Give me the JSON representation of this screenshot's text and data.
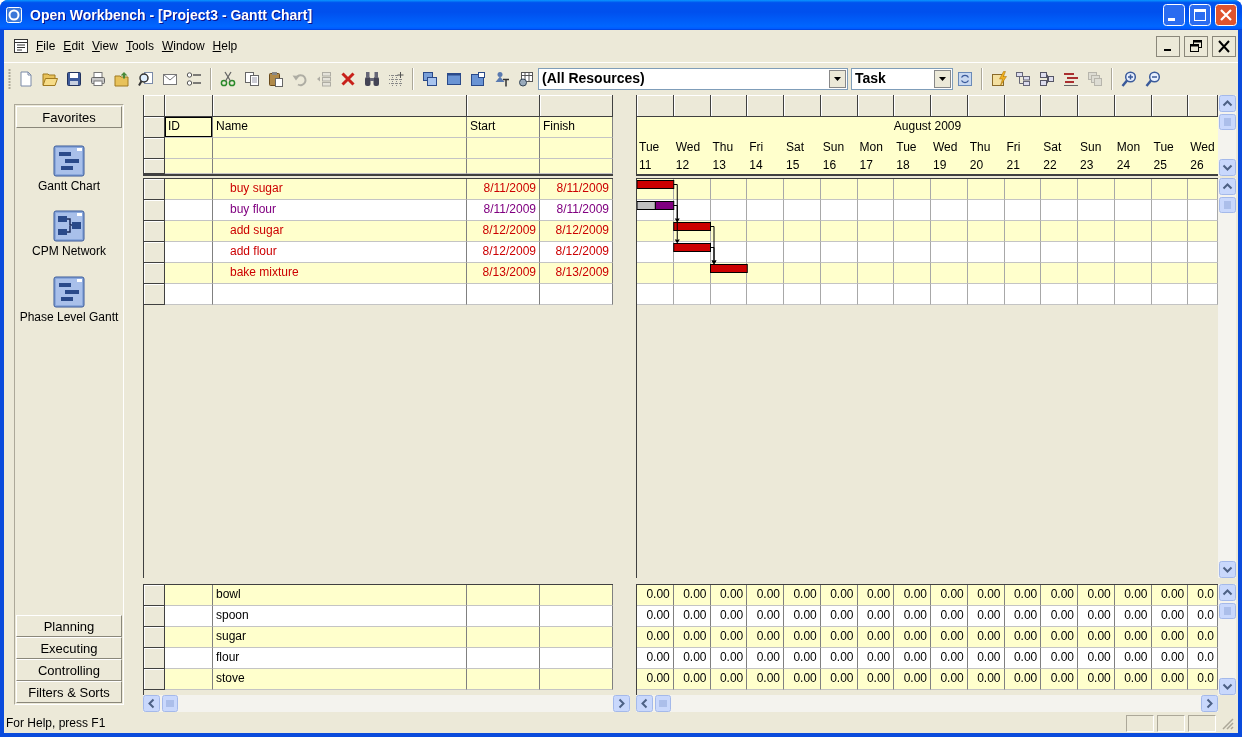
{
  "window": {
    "title": "Open Workbench - [Project3 - Gantt Chart]"
  },
  "menu": [
    {
      "label": "File"
    },
    {
      "label": "Edit"
    },
    {
      "label": "View"
    },
    {
      "label": "Tools"
    },
    {
      "label": "Window"
    },
    {
      "label": "Help"
    }
  ],
  "toolbar": {
    "items": [
      {
        "kind": "button",
        "disabled": false
      },
      {
        "kind": "button",
        "disabled": false
      },
      {
        "kind": "button",
        "disabled": false
      },
      {
        "kind": "button",
        "disabled": false
      },
      {
        "kind": "button",
        "disabled": false
      },
      {
        "kind": "button",
        "disabled": false
      },
      {
        "kind": "button",
        "disabled": false
      },
      {
        "kind": "button",
        "disabled": false
      },
      {
        "kind": "separator"
      },
      {
        "kind": "button",
        "disabled": false
      },
      {
        "kind": "button",
        "disabled": false
      },
      {
        "kind": "button",
        "disabled": false
      },
      {
        "kind": "button",
        "disabled": true
      },
      {
        "kind": "button",
        "disabled": true
      },
      {
        "kind": "button",
        "disabled": false
      },
      {
        "kind": "button",
        "disabled": false
      },
      {
        "kind": "button",
        "disabled": false
      },
      {
        "kind": "separator"
      },
      {
        "kind": "button",
        "disabled": false
      },
      {
        "kind": "button",
        "disabled": false
      },
      {
        "kind": "button",
        "disabled": false
      },
      {
        "kind": "button",
        "disabled": false
      },
      {
        "kind": "button",
        "disabled": false
      },
      {
        "kind": "dropdown",
        "value": "(All Resources)"
      },
      {
        "kind": "dropdown",
        "value": "Task"
      },
      {
        "kind": "button",
        "disabled": false
      },
      {
        "kind": "separator"
      },
      {
        "kind": "button",
        "disabled": false
      },
      {
        "kind": "button",
        "disabled": false
      },
      {
        "kind": "button",
        "disabled": false
      },
      {
        "kind": "button",
        "disabled": false
      },
      {
        "kind": "button",
        "disabled": true
      },
      {
        "kind": "separator"
      },
      {
        "kind": "button",
        "disabled": false
      },
      {
        "kind": "button",
        "disabled": false
      }
    ]
  },
  "sidebar": {
    "open_group": {
      "label": "Favorites",
      "items": [
        {
          "label": "Gantt Chart",
          "kind": "gantt"
        },
        {
          "label": "CPM Network",
          "kind": "network"
        },
        {
          "label": "Phase Level Gantt",
          "kind": "gantt"
        }
      ]
    },
    "collapsed_groups": [
      {
        "label": "Planning"
      },
      {
        "label": "Executing"
      },
      {
        "label": "Controlling"
      },
      {
        "label": "Filters & Sorts"
      }
    ]
  },
  "task_grid": {
    "columns": [
      {
        "label": "ID",
        "focused": true
      },
      {
        "label": "Name",
        "focused": false
      },
      {
        "label": "Start",
        "focused": false
      },
      {
        "label": "Finish",
        "focused": false
      }
    ],
    "rows": [
      {
        "name": "buy sugar",
        "start": "8/11/2009",
        "finish": "8/11/2009",
        "color": "#cc0000"
      },
      {
        "name": "buy flour",
        "start": "8/11/2009",
        "finish": "8/11/2009",
        "color": "#800080"
      },
      {
        "name": "add sugar",
        "start": "8/12/2009",
        "finish": "8/12/2009",
        "color": "#cc0000"
      },
      {
        "name": "add flour",
        "start": "8/12/2009",
        "finish": "8/12/2009",
        "color": "#cc0000"
      },
      {
        "name": "bake mixture",
        "start": "8/13/2009",
        "finish": "8/13/2009",
        "color": "#cc0000"
      }
    ]
  },
  "gantt": {
    "timescale": {
      "month": "August 2009",
      "days": [
        {
          "weekday": "Tue",
          "date": "11"
        },
        {
          "weekday": "Wed",
          "date": "12"
        },
        {
          "weekday": "Thu",
          "date": "13"
        },
        {
          "weekday": "Fri",
          "date": "14"
        },
        {
          "weekday": "Sat",
          "date": "15"
        },
        {
          "weekday": "Sun",
          "date": "16"
        },
        {
          "weekday": "Mon",
          "date": "17"
        },
        {
          "weekday": "Tue",
          "date": "18"
        },
        {
          "weekday": "Wed",
          "date": "19"
        },
        {
          "weekday": "Thu",
          "date": "20"
        },
        {
          "weekday": "Fri",
          "date": "21"
        },
        {
          "weekday": "Sat",
          "date": "22"
        },
        {
          "weekday": "Sun",
          "date": "23"
        },
        {
          "weekday": "Mon",
          "date": "24"
        },
        {
          "weekday": "Tue",
          "date": "25"
        },
        {
          "weekday": "Wed",
          "date": "26"
        }
      ]
    }
  },
  "resource_grid": {
    "rows": [
      {
        "name": "bowl",
        "values": [
          "0.00",
          "0.00",
          "0.00",
          "0.00",
          "0.00",
          "0.00",
          "0.00",
          "0.00",
          "0.00",
          "0.00",
          "0.00",
          "0.00",
          "0.00",
          "0.00",
          "0.00",
          "0.0"
        ]
      },
      {
        "name": "spoon",
        "values": [
          "0.00",
          "0.00",
          "0.00",
          "0.00",
          "0.00",
          "0.00",
          "0.00",
          "0.00",
          "0.00",
          "0.00",
          "0.00",
          "0.00",
          "0.00",
          "0.00",
          "0.00",
          "0.0"
        ]
      },
      {
        "name": "sugar",
        "values": [
          "0.00",
          "0.00",
          "0.00",
          "0.00",
          "0.00",
          "0.00",
          "0.00",
          "0.00",
          "0.00",
          "0.00",
          "0.00",
          "0.00",
          "0.00",
          "0.00",
          "0.00",
          "0.0"
        ]
      },
      {
        "name": "flour",
        "values": [
          "0.00",
          "0.00",
          "0.00",
          "0.00",
          "0.00",
          "0.00",
          "0.00",
          "0.00",
          "0.00",
          "0.00",
          "0.00",
          "0.00",
          "0.00",
          "0.00",
          "0.00",
          "0.0"
        ]
      },
      {
        "name": "stove",
        "values": [
          "0.00",
          "0.00",
          "0.00",
          "0.00",
          "0.00",
          "0.00",
          "0.00",
          "0.00",
          "0.00",
          "0.00",
          "0.00",
          "0.00",
          "0.00",
          "0.00",
          "0.00",
          "0.0"
        ]
      }
    ]
  },
  "status_bar": {
    "text": "For Help, press F1"
  }
}
